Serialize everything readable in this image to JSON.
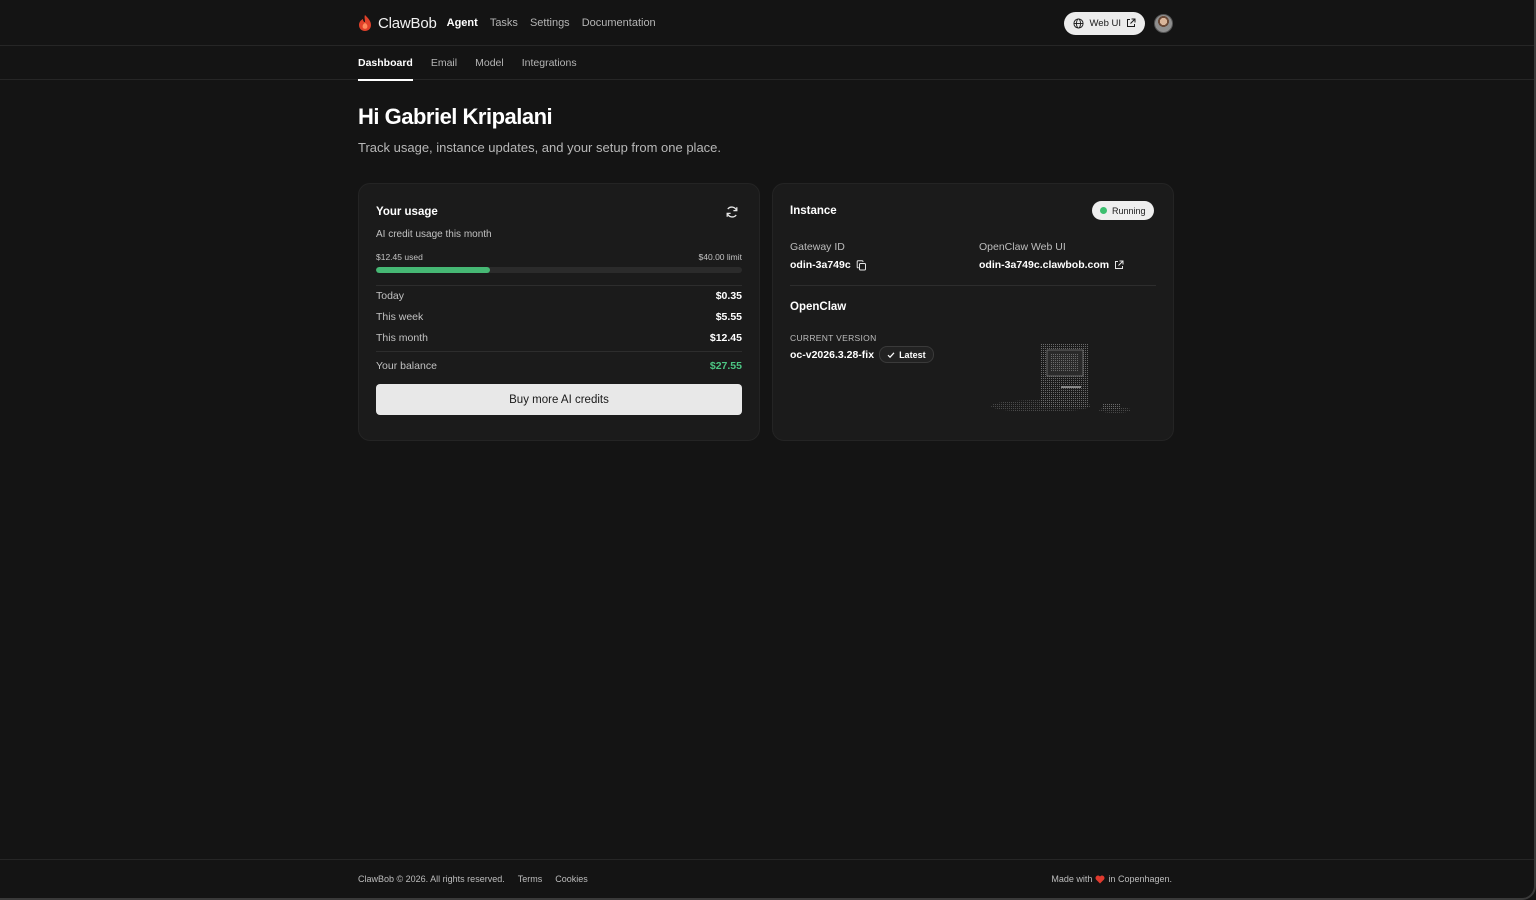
{
  "topnav": {
    "brand": "ClawBob",
    "links": [
      "Agent",
      "Tasks",
      "Settings",
      "Documentation"
    ],
    "active_link": "Agent",
    "web_ui_label": "Web UI"
  },
  "subtabs": {
    "items": [
      "Dashboard",
      "Email",
      "Model",
      "Integrations"
    ],
    "active": "Dashboard"
  },
  "header": {
    "greeting": "Hi Gabriel Kripalani",
    "subtitle": "Track usage, instance updates, and your setup from one place."
  },
  "usage": {
    "title": "Your usage",
    "subtitle": "AI credit usage this month",
    "used_label": "$12.45 used",
    "limit_label": "$40.00 limit",
    "progress_fraction": 0.311,
    "rows": [
      {
        "label": "Today",
        "value": "$0.35"
      },
      {
        "label": "This week",
        "value": "$5.55"
      },
      {
        "label": "This month",
        "value": "$12.45"
      }
    ],
    "balance_label": "Your balance",
    "balance_value": "$27.55",
    "buy_button": "Buy more AI credits"
  },
  "instance": {
    "title": "Instance",
    "status": "Running",
    "gateway_label": "Gateway ID",
    "gateway_value": "odin-3a749c",
    "webui_label": "OpenClaw Web UI",
    "webui_value": "odin-3a749c.clawbob.com",
    "openclaw_title": "OpenClaw",
    "version_label": "CURRENT VERSION",
    "version_value": "oc-v2026.3.28-fix",
    "latest_badge": "Latest"
  },
  "footer": {
    "copyright": "ClawBob © 2026. All rights reserved.",
    "links": [
      "Terms",
      "Cookies"
    ],
    "made_with_prefix": "Made with",
    "made_with_suffix": "in Copenhagen."
  },
  "colors": {
    "accent_green": "#46b874",
    "brand_red": "#e0412a",
    "background": "#141414"
  }
}
